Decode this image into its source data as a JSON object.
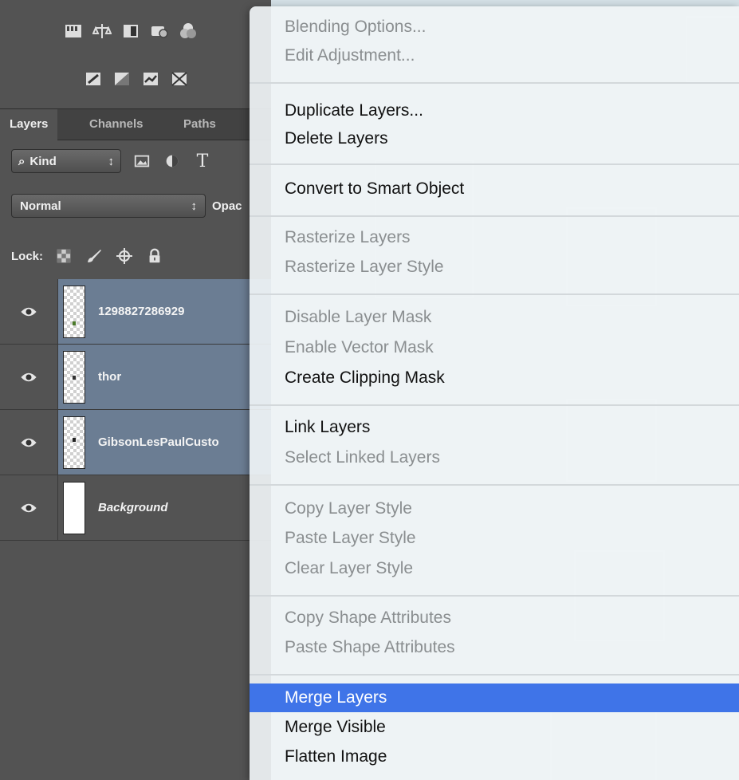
{
  "panel": {
    "tabs": [
      "Layers",
      "Channels",
      "Paths"
    ],
    "kind_label": "Kind",
    "blend_mode": "Normal",
    "opacity_label": "Opac",
    "lock_label": "Lock:",
    "layers": [
      {
        "name": "1298827286929",
        "selected": true,
        "visible": true
      },
      {
        "name": "thor",
        "selected": true,
        "visible": true
      },
      {
        "name": "GibsonLesPaulCusto",
        "selected": true,
        "visible": true
      },
      {
        "name": "Background",
        "selected": false,
        "visible": true
      }
    ]
  },
  "menu": {
    "items": [
      {
        "label": "Blending Options...",
        "state": "disabled"
      },
      {
        "label": "Edit Adjustment...",
        "state": "disabled"
      },
      {
        "label": "Duplicate Layers...",
        "state": "enabled"
      },
      {
        "label": "Delete Layers",
        "state": "enabled"
      },
      {
        "label": "Convert to Smart Object",
        "state": "enabled"
      },
      {
        "label": "Rasterize Layers",
        "state": "disabled"
      },
      {
        "label": "Rasterize Layer Style",
        "state": "disabled"
      },
      {
        "label": "Disable Layer Mask",
        "state": "disabled"
      },
      {
        "label": "Enable Vector Mask",
        "state": "disabled"
      },
      {
        "label": "Create Clipping Mask",
        "state": "enabled"
      },
      {
        "label": "Link Layers",
        "state": "enabled"
      },
      {
        "label": "Select Linked Layers",
        "state": "disabled"
      },
      {
        "label": "Copy Layer Style",
        "state": "disabled"
      },
      {
        "label": "Paste Layer Style",
        "state": "disabled"
      },
      {
        "label": "Clear Layer Style",
        "state": "disabled"
      },
      {
        "label": "Copy Shape Attributes",
        "state": "disabled"
      },
      {
        "label": "Paste Shape Attributes",
        "state": "disabled"
      },
      {
        "label": "Merge Layers",
        "state": "highlighted"
      },
      {
        "label": "Merge Visible",
        "state": "enabled"
      },
      {
        "label": "Flatten Image",
        "state": "enabled"
      }
    ]
  },
  "colors": {
    "panel_bg": "#535353",
    "selected_layer": "#6b7d93",
    "menu_highlight": "#3f74e8"
  }
}
